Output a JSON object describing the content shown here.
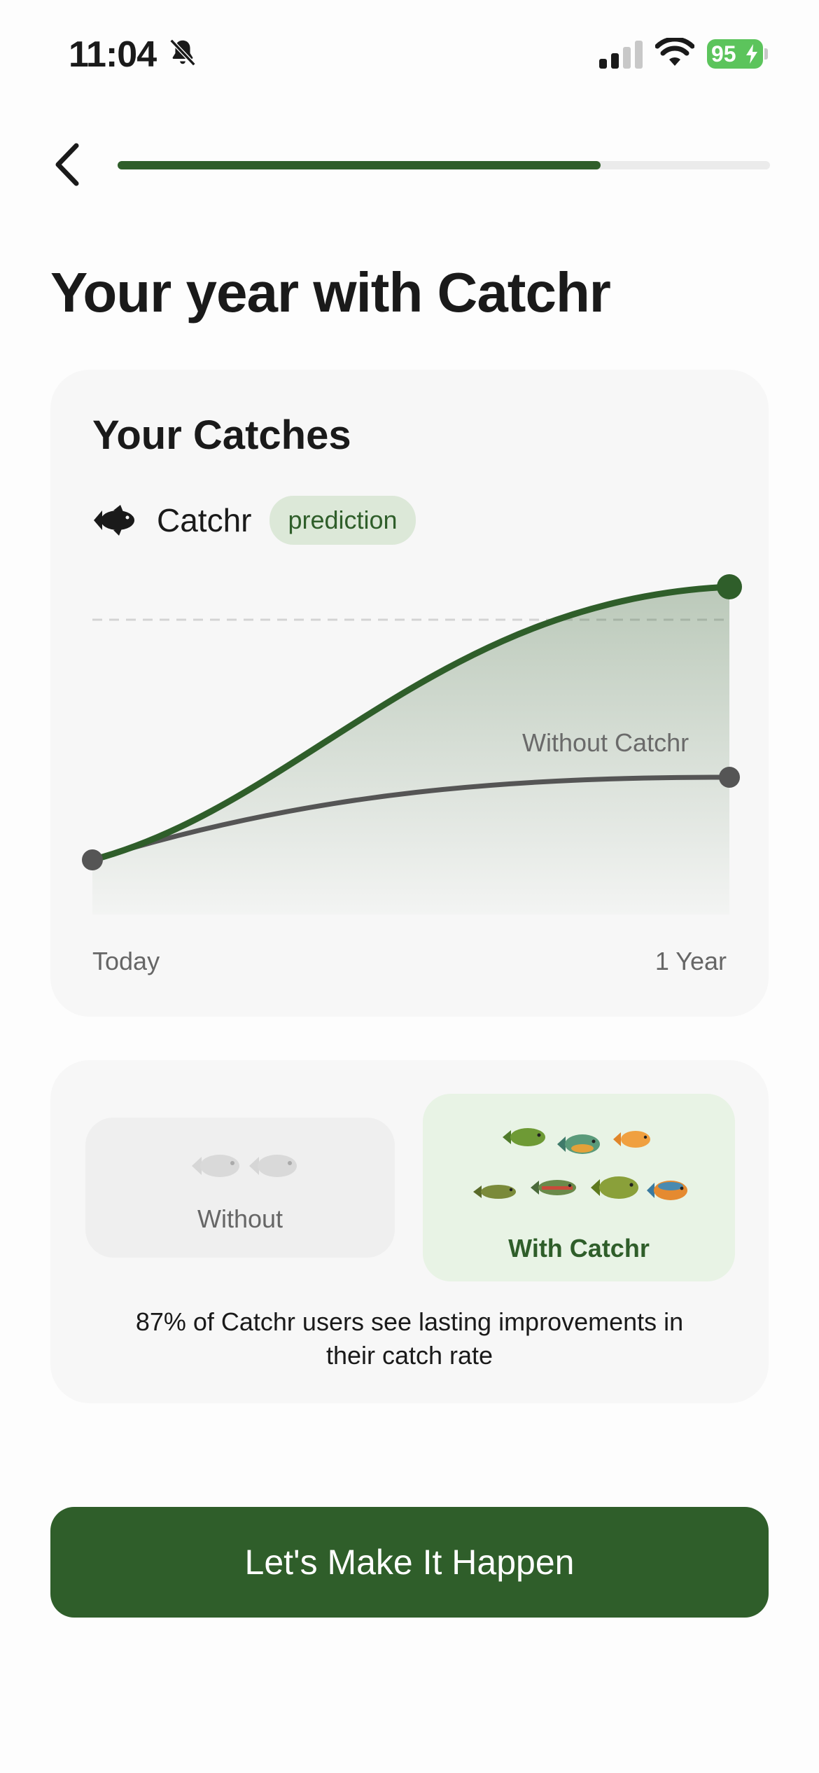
{
  "status_bar": {
    "time": "11:04",
    "battery": "95",
    "icons": [
      "bell-slash-icon",
      "signal-icon",
      "wifi-icon",
      "battery-icon"
    ]
  },
  "header": {
    "progress": 0.74
  },
  "page": {
    "title": "Your year with Catchr"
  },
  "chart_card": {
    "title": "Your Catches",
    "legend_label": "Catchr",
    "badge": "prediction",
    "without_label": "Without Catchr",
    "x_start": "Today",
    "x_end": "1 Year"
  },
  "chart_data": {
    "type": "line",
    "x": [
      "Today",
      "1 Year"
    ],
    "series": [
      {
        "name": "Catchr",
        "start": 0.18,
        "end": 1.0,
        "color": "#2F5E2A"
      },
      {
        "name": "Without Catchr",
        "start": 0.18,
        "end": 0.43,
        "color": "#555555"
      }
    ],
    "grid": "dashed reference line near top"
  },
  "compare_card": {
    "without_label": "Without",
    "with_label": "With Catchr",
    "stat_line1": "87% of Catchr users see lasting improvements in",
    "stat_line2": "their catch rate"
  },
  "cta": {
    "label": "Let's Make It Happen"
  },
  "colors": {
    "accent": "#2F5E2A",
    "badge_bg": "#DCE8D8",
    "with_bg": "#E8F3E5"
  }
}
